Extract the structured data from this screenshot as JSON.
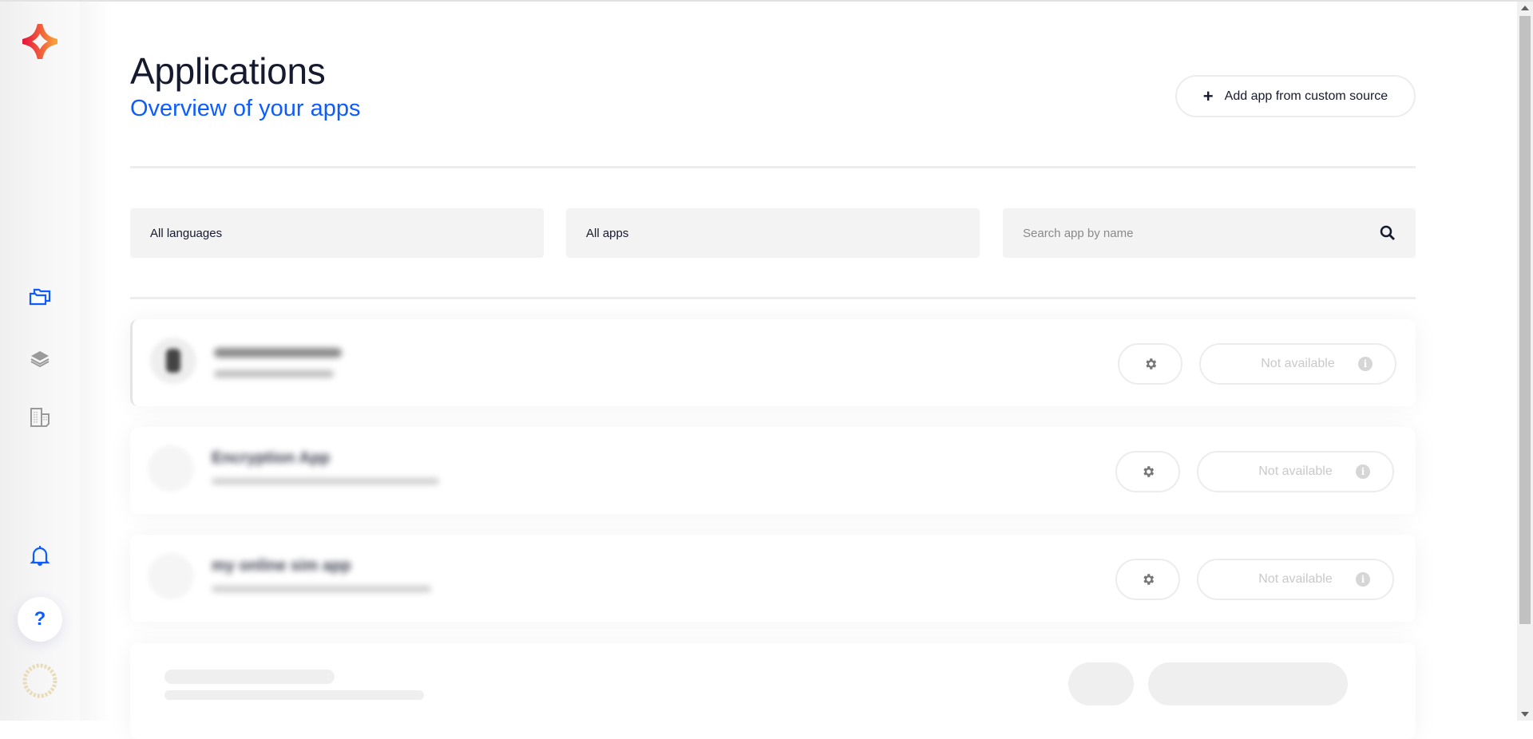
{
  "header": {
    "title": "Applications",
    "subtitle": "Overview of your apps",
    "add_button": "Add app from custom source",
    "add_icon": "+"
  },
  "filters": {
    "language": "All languages",
    "apps": "All apps",
    "search_placeholder": "Search app by name"
  },
  "apps": [
    {
      "name": "",
      "subtitle": "",
      "status": "Not available"
    },
    {
      "name": "Encryption App",
      "subtitle": "",
      "status": "Not available"
    },
    {
      "name": "my online sim app",
      "subtitle": "",
      "status": "Not available"
    }
  ],
  "sidebar": {
    "help_label": "?",
    "items": [
      "folders-icon",
      "layers-icon",
      "buildings-icon",
      "bell-icon"
    ]
  },
  "colors": {
    "accent": "#0d5cff",
    "title": "#161a2e",
    "filter_bg": "#f3f3f3"
  }
}
